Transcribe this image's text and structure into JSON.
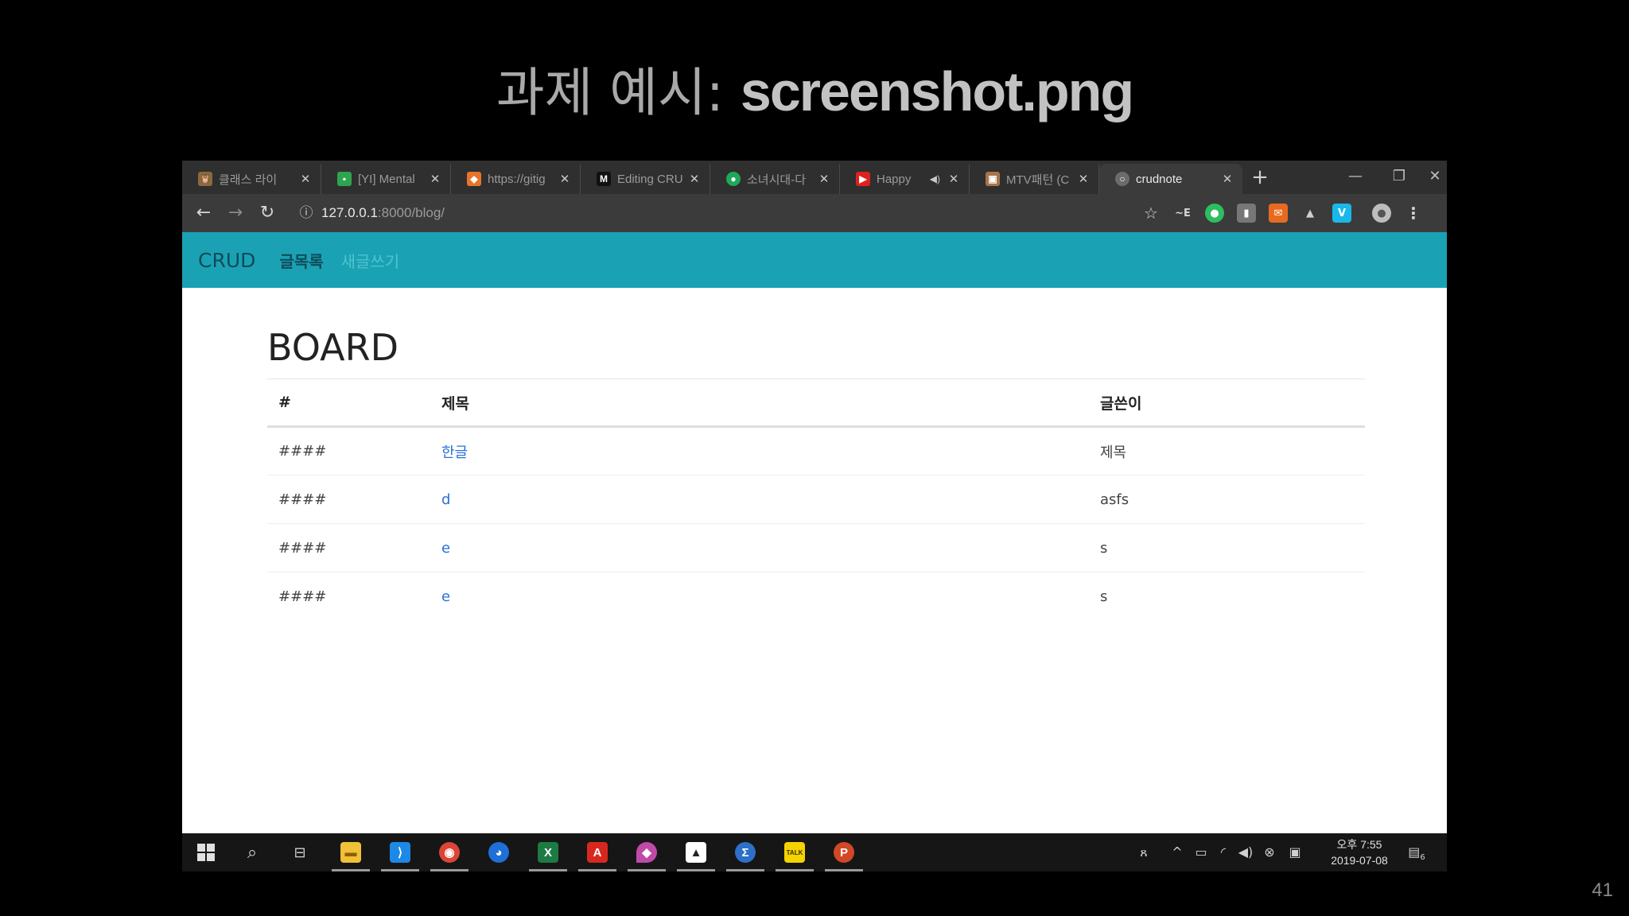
{
  "slide": {
    "title_kr": "과제 예시: ",
    "title_en": "screenshot.png",
    "page_number": "41"
  },
  "browser": {
    "tabs": [
      {
        "label": "클래스 라이",
        "favicon": "owl-icon",
        "color": "#8a6a3a"
      },
      {
        "label": "[YI] Mental",
        "favicon": "chat-icon",
        "color": "#2ea44f"
      },
      {
        "label": "https://gitig",
        "favicon": "gitlab-icon",
        "color": "#e8742b"
      },
      {
        "label": "Editing CRU",
        "favicon": "medium-icon",
        "color": "#111111"
      },
      {
        "label": "소녀시대-다",
        "favicon": "melon-icon",
        "color": "#1fa85a"
      },
      {
        "label": "Happy",
        "favicon": "youtube-icon",
        "color": "#e02020",
        "muted": true
      },
      {
        "label": "MTV패턴 (C",
        "favicon": "photo-icon",
        "color": "#a9744a"
      },
      {
        "label": "crudnote",
        "favicon": "globe-icon",
        "color": "#6b6b6b",
        "active": true
      }
    ],
    "new_tab_label": "+",
    "url_host": "127.0.0.1",
    "url_path": ":8000/blog/",
    "extensions": [
      {
        "name": "star-icon",
        "glyph": "☆",
        "color": "transparent"
      },
      {
        "name": "translate-icon",
        "glyph": "~E",
        "color": "transparent"
      },
      {
        "name": "evernote-icon",
        "glyph": "●",
        "color": "#2dbe60"
      },
      {
        "name": "reader-icon",
        "glyph": "▮",
        "color": "#777777"
      },
      {
        "name": "mail-icon",
        "glyph": "✉",
        "color": "#e86a1e"
      },
      {
        "name": "drive-icon",
        "glyph": "▲",
        "color": "transparent"
      },
      {
        "name": "vimeo-icon",
        "glyph": "V",
        "color": "#1ab7ea"
      },
      {
        "name": "profile-avatar-icon",
        "glyph": "●",
        "color": "#bdbdbd"
      },
      {
        "name": "menu-kebab-icon",
        "glyph": "⋮",
        "color": "transparent"
      }
    ]
  },
  "nav": {
    "brand": "CRUD",
    "links": [
      "글목록",
      "새글쓰기"
    ]
  },
  "board": {
    "title": "BOARD",
    "headers": [
      "#",
      "제목",
      "글쓴이"
    ],
    "rows": [
      {
        "num": "####",
        "title": "한글",
        "author": "제목"
      },
      {
        "num": "####",
        "title": "d",
        "author": "asfs"
      },
      {
        "num": "####",
        "title": "e",
        "author": "s"
      },
      {
        "num": "####",
        "title": "e",
        "author": "s"
      }
    ]
  },
  "taskbar": {
    "clock_line1": "오후 7:55",
    "clock_line2": "2019-07-08",
    "notification_count": "6",
    "apps": [
      {
        "name": "file-explorer-icon",
        "glyph": "▬",
        "color": "#f2c037",
        "open": true
      },
      {
        "name": "vscode-icon",
        "glyph": "⟩",
        "color": "#1e88e5",
        "open": true
      },
      {
        "name": "chrome-icon",
        "glyph": "◉",
        "color": "#db4437",
        "open": true
      },
      {
        "name": "firefox-icon",
        "glyph": "◕",
        "color": "#1e6fd8",
        "open": false
      },
      {
        "name": "excel-icon",
        "glyph": "X",
        "color": "#1d7a44",
        "open": true
      },
      {
        "name": "acrobat-icon",
        "glyph": "A",
        "color": "#d7281f",
        "open": true
      },
      {
        "name": "maps-pin-icon",
        "glyph": "◆",
        "color": "#c04aa8",
        "open": true
      },
      {
        "name": "photos-icon",
        "glyph": "▲",
        "color": "#333333",
        "open": true
      },
      {
        "name": "sigma-icon",
        "glyph": "Σ",
        "color": "#2d6fc9",
        "open": true
      },
      {
        "name": "kakaotalk-icon",
        "glyph": "TALK",
        "color": "#f5d300",
        "open": true
      },
      {
        "name": "powerpoint-icon",
        "glyph": "P",
        "color": "#d24726",
        "open": true
      }
    ]
  }
}
